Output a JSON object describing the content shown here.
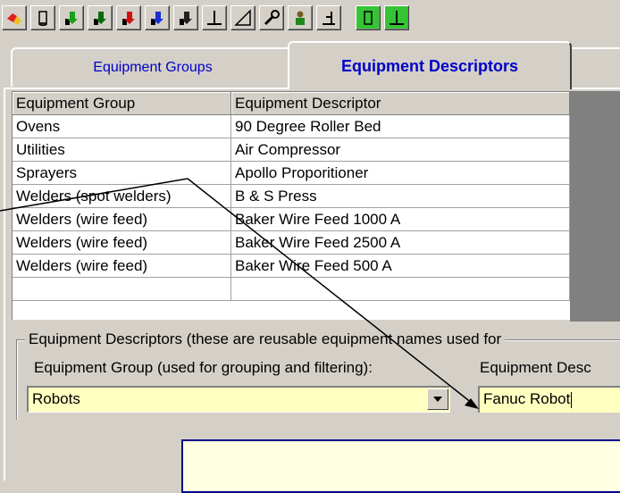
{
  "toolbar": {
    "buttons": [
      {
        "icon": "component-red-icon"
      },
      {
        "icon": "cylinder-icon"
      },
      {
        "icon": "import-green-icon"
      },
      {
        "icon": "import-dark-green-icon"
      },
      {
        "icon": "import-red-icon"
      },
      {
        "icon": "import-blue-icon"
      },
      {
        "icon": "import-black-icon"
      },
      {
        "icon": "angle-icon"
      },
      {
        "icon": "chart-icon"
      },
      {
        "icon": "wrench-icon"
      },
      {
        "icon": "person-icon"
      },
      {
        "icon": "fill-icon"
      },
      {
        "icon": "green-cylinder-icon"
      },
      {
        "icon": "green-angle-icon"
      }
    ]
  },
  "tabs": {
    "equipment_groups": "Equipment Groups",
    "equipment_descriptors": "Equipment Descriptors"
  },
  "grid": {
    "headers": [
      "Equipment Group",
      "Equipment Descriptor"
    ],
    "rows": [
      [
        "Ovens",
        "90 Degree Roller Bed"
      ],
      [
        "Utilities",
        "Air Compressor"
      ],
      [
        "Sprayers",
        "Apollo Proporitioner"
      ],
      [
        "Welders (spot welders)",
        "B & S Press"
      ],
      [
        "Welders (wire feed)",
        "Baker Wire Feed 1000 A"
      ],
      [
        "Welders (wire feed)",
        "Baker Wire Feed 2500 A"
      ],
      [
        "Welders (wire feed)",
        "Baker Wire Feed 500 A"
      ]
    ]
  },
  "form": {
    "groupbox_title": "Equipment Descriptors (these are reusable equipment names used for",
    "group_label": "Equipment Group (used for grouping and filtering):",
    "group_value": "Robots",
    "descriptor_label": "Equipment Desc",
    "descriptor_value": "Fanuc Robot"
  },
  "colors": {
    "window_bg": "#d4d0c8",
    "field_bg": "#ffffc0",
    "tab_text": "#0000c8",
    "tooltip_border": "#00008b"
  }
}
